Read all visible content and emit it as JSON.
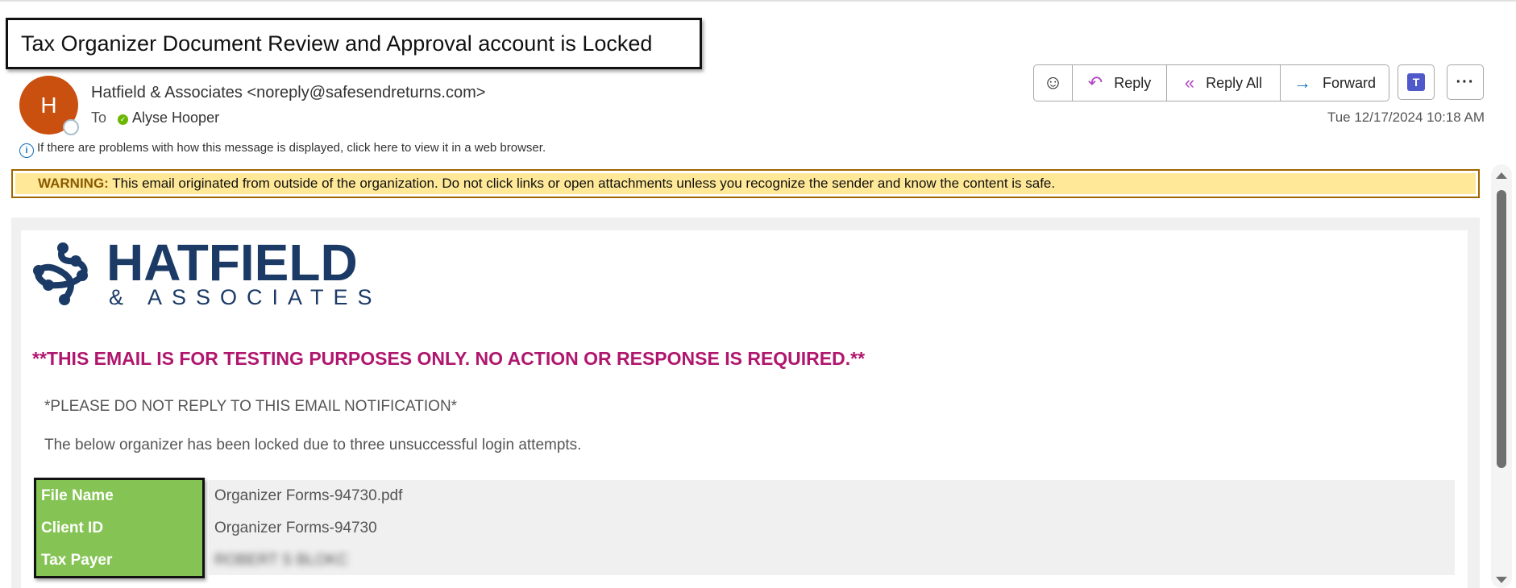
{
  "subject": "Tax Organizer Document Review and Approval account is Locked",
  "sender": {
    "initial": "H",
    "display": "Hatfield & Associates <noreply@safesendreturns.com>",
    "avatar_color": "#ca5010"
  },
  "recipients": {
    "to_label": "To",
    "name": "Alyse Hooper"
  },
  "info_bar": "If there are problems with how this message is displayed, click here to view it in a web browser.",
  "actions": {
    "reply": "Reply",
    "reply_all": "Reply All",
    "forward": "Forward"
  },
  "date": "Tue 12/17/2024 10:18 AM",
  "warning": {
    "label": "WARNING:",
    "text": " This email originated from outside of the organization. Do not click links or open attachments unless you recognize the sender and know the content is safe."
  },
  "body": {
    "logo": {
      "name": "HATFIELD",
      "sub": "& ASSOCIATES",
      "color": "#1b3a66"
    },
    "testing_notice": "**THIS EMAIL IS FOR TESTING PURPOSES ONLY. NO ACTION OR RESPONSE IS REQUIRED.**",
    "no_reply": "*PLEASE DO NOT REPLY TO THIS EMAIL NOTIFICATION*",
    "message": "The below organizer has been locked due to three unsuccessful login attempts.",
    "table": [
      {
        "label": "File Name",
        "value": "Organizer Forms-94730.pdf"
      },
      {
        "label": "Client ID",
        "value": "Organizer Forms-94730"
      },
      {
        "label": "Tax Payer",
        "value": "ROBERT S BLOKC"
      }
    ]
  }
}
